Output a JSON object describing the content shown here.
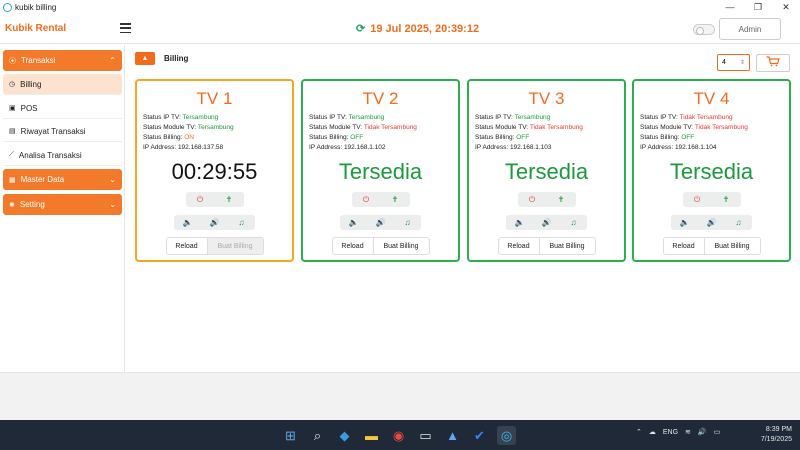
{
  "window": {
    "title": "kubik billing",
    "minimize": "—",
    "maximize": "❐",
    "close": "✕"
  },
  "topbar": {
    "brand": "Kubik Rental",
    "datetime": "19 Jul 2025, 20:39:12",
    "admin_label": "Admin",
    "refresh_icon": "⟳"
  },
  "sidebar": {
    "transaksi": "Transaksi",
    "items": [
      {
        "label": "Billing",
        "icon": "◷"
      },
      {
        "label": "POS",
        "icon": "▣"
      },
      {
        "label": "Riwayat Transaksi",
        "icon": "▤"
      },
      {
        "label": "Analisa Transaksi",
        "icon": "⟋"
      }
    ],
    "master_data": "Master Data",
    "setting": "Setting",
    "chev_up": "⌃",
    "chev_down": "⌄"
  },
  "main": {
    "back_icon": "▲",
    "section_title": "Billing",
    "qty_value": "4",
    "cart_icon": "🛒"
  },
  "labels": {
    "ip_tv": "Status IP TV: ",
    "module_tv": "Status Module TV: ",
    "billing": "Status Billing: ",
    "ip_address": "IP Address: "
  },
  "cards": [
    {
      "name": "TV 1",
      "ip_tv": "Tersambung",
      "module_tv": "Tersambung",
      "billing": "ON",
      "ip": "192.168.137.58",
      "display": "00:29:55",
      "reload": "Reload",
      "buat": "Buat Billing"
    },
    {
      "name": "TV 2",
      "ip_tv": "Tersambung",
      "module_tv": "Tidak Tersambung",
      "billing": "OFF",
      "ip": "192.168.1.102",
      "display": "Tersedia",
      "reload": "Reload",
      "buat": "Buat Billing"
    },
    {
      "name": "TV 3",
      "ip_tv": "Tersambung",
      "module_tv": "Tidak Tersambung",
      "billing": "OFF",
      "ip": "192.168.1.103",
      "display": "Tersedia",
      "reload": "Reload",
      "buat": "Buat Billing"
    },
    {
      "name": "TV 4",
      "ip_tv": "Tidak Tersambung",
      "module_tv": "Tidak Tersambung",
      "billing": "OFF",
      "ip": "192.168.1.104",
      "display": "Tersedia",
      "reload": "Reload",
      "buat": "Buat Billing"
    }
  ],
  "icons": {
    "power": "⏻",
    "person": "✝",
    "vol_down": "🔈",
    "vol_up": "🔊",
    "mic": "♫"
  },
  "taskbar": {
    "lang": "ENG",
    "time": "8:39 PM",
    "date": "7/19/2025"
  },
  "colors": {
    "accent": "#f26b1d",
    "ok": "#1b9a3c",
    "bad": "#e53935",
    "busy_border": "#f5a623"
  }
}
